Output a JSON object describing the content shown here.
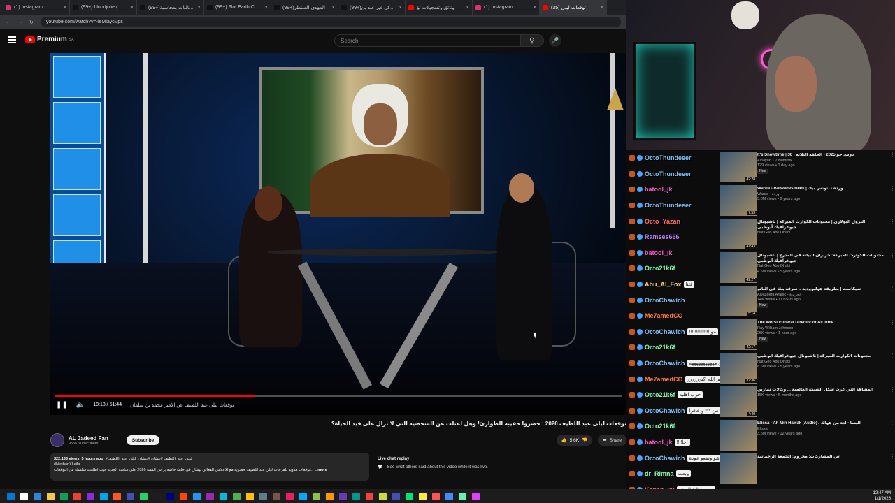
{
  "browser": {
    "tabs": [
      {
        "title": "(1) Instagram",
        "color": "#e1306c",
        "active": false
      },
      {
        "title": "(99+) blondjolie (@bl...",
        "color": "#111111",
        "active": false
      },
      {
        "title": "(99+)مطالبات بمحاسبة",
        "color": "#111111",
        "active": false
      },
      {
        "title": "(99+) Flat Earth Challe...",
        "color": "#111111",
        "active": false
      },
      {
        "title": "(99+)المهدي المنتظر",
        "color": "#111111",
        "active": false
      },
      {
        "title": "(99+)فهوكل غير عند بن",
        "color": "#111111",
        "active": false
      },
      {
        "title": "وثائق وتسجيلات تؤ",
        "color": "#ff0000",
        "active": false
      },
      {
        "title": "(1) Instagram",
        "color": "#e1306c",
        "active": false
      },
      {
        "title": "(35) توقعات ليلى",
        "color": "#ff0000",
        "active": true
      }
    ],
    "url": "youtube.com/watch?v=-leMiaycVps"
  },
  "youtube": {
    "logo_text": "Premium",
    "logo_region": "SA",
    "search_placeholder": "Search"
  },
  "player": {
    "time_current": "18:18",
    "time_total": "51:44",
    "time_display": "18:18 / 51:44",
    "chapter": "توقعات ليلى عبد اللطيف عن الأمير محمد بن سلمان",
    "progress_fraction": 0.354
  },
  "video": {
    "title": "توقعات ليلى عبد اللطيف 2026 : حضروا حقيبة الطوارئ! وهل اعتلت عن الشخصية التي لا تزال على قيد الحياة؟",
    "channel": "AL Jadeed Fan",
    "subscribers": "955K subscribers",
    "subscribe_label": "Subscribe",
    "likes": "5.6K",
    "share_label": "Share",
    "views": "322,133 views",
    "posted": "5 hours ago",
    "hashtags": "#ليلى_عبد_اللطيف #نيشان #نيشان_ليلى_عبد_اللطيف",
    "hashtag2": "#NeshanXLeila",
    "desc_text": "توقعات مدوية للفرحات ليلى عبد اللطيف حضرية مع الاعلامي الفعالي نيشان في حلقة خاصة برأس السنة 2026 على شاشة الجديد حيث اطلقت سلسلة من التوقعات...",
    "more_label": "...more"
  },
  "live_chat": {
    "title": "Live chat replay",
    "subtitle": "See what others said about this video while it was live."
  },
  "chat_messages": [
    {
      "user": "OctoThundeeer",
      "color": "#7ec8ff",
      "text": ""
    },
    {
      "user": "OctoThundeeer",
      "color": "#7ec8ff",
      "text": ""
    },
    {
      "user": "batool_jk",
      "color": "#ff5ad0",
      "text": ""
    },
    {
      "user": "OctoThundeeer",
      "color": "#7ec8ff",
      "text": ""
    },
    {
      "user": "Octo_Yazan",
      "color": "#ff6a6a",
      "text": ""
    },
    {
      "user": "Ramses666",
      "color": "#c77dff",
      "text": ""
    },
    {
      "user": "batool_jk",
      "color": "#ff5ad0",
      "text": ""
    },
    {
      "user": "Octo21k6f",
      "color": "#7dffb0",
      "text": ""
    },
    {
      "user": "Abu_Al_Fox",
      "color": "#ffd75a",
      "text": "فتنا"
    },
    {
      "user": "OctoChawich",
      "color": "#7ec8ff",
      "text": ""
    },
    {
      "user": "Me7amedCO",
      "color": "#ff7b3a",
      "text": ""
    },
    {
      "user": "OctoChawich",
      "color": "#7ec8ff",
      "text": "مو !!!!!!!!!!!!!!!"
    },
    {
      "user": "Octo21k6f",
      "color": "#7dffb0",
      "text": ""
    },
    {
      "user": "OctoChawich",
      "color": "#7ec8ff",
      "text": "وعدي هههههههههههه"
    },
    {
      "user": "Me7amedCO",
      "color": "#ff7b3a",
      "text": "تفجير الله اكبرررررر"
    },
    {
      "user": "Octo21k6f",
      "color": "#7dffb0",
      "text": "حرب اهليه"
    },
    {
      "user": "OctoChawich",
      "color": "#7ec8ff",
      "text": "ماسبدفين خلصنا من *** و عافرا"
    },
    {
      "user": "Octo21k6f",
      "color": "#7dffb0",
      "text": ""
    },
    {
      "user": "batool_jk",
      "color": "#ff5ad0",
      "text": "احا!!!!"
    },
    {
      "user": "OctoChawich",
      "color": "#7ec8ff",
      "text": "شو وضعو عودة"
    },
    {
      "user": "dr_Rimna",
      "color": "#7dffb0",
      "text": "وبعت"
    },
    {
      "user": "Kenan_xy",
      "color": "#ff6a6a",
      "text": "حرب اهلية الوضع"
    }
  ],
  "recommendations": [
    {
      "title": "It's Snowtime | 30 | دوس جو 2025 - الحلقة الثلاثة",
      "meta1": "Alhayah TV Network",
      "meta2": "129 views • 1 day ago",
      "badge": "New",
      "duration": "42:28"
    },
    {
      "title": "Warda - Batwanes Beek | وردة - بتونس بيك",
      "meta1": "Warda - وردة",
      "meta2": "3.8M views • 9 years ago",
      "badge": "",
      "duration": "7:53"
    },
    {
      "title": "الترول البولاري | مجنونات الكوارث المبركة | ناشيونال جيوغرافيك أبوظبي",
      "meta1": "Nat Geo Abu Dhabi",
      "meta2": "",
      "badge": "",
      "duration": "41:43"
    },
    {
      "title": "مجنونات الكوارث المبركة: حريزان البيانه في المدرج | ناشيونال جيوغرافيك أبوظبي",
      "meta1": "Nat Geo Abu Dhabi",
      "meta2": "4.5M views • 5 years ago",
      "badge": "",
      "duration": "42:27"
    },
    {
      "title": "شيكاست | بطريقة هوليوودية .. سرقة بنك في الناتو",
      "meta1": "AlJazeera Arabic - الجزيرة",
      "meta2": "14K views • 11 hours ago",
      "badge": "New",
      "duration": "5:14"
    },
    {
      "title": "The Worst Funeral Director of All Time",
      "meta1": "Ray William Johnson",
      "meta2": "25K views • 1 hour ago",
      "badge": "New",
      "duration": "42:17"
    },
    {
      "title": "مجنونات الكوارث المبركة | ناشيونال جيوغرافيك أبوظبي",
      "meta1": "Nat Geo Abu Dhabi",
      "meta2": "8.6M views • 5 years ago",
      "badge": "",
      "duration": "37:36"
    },
    {
      "title": "المشاهد التي عرت شكل الشبكة العالمية ... وكالات تمارين",
      "meta1": "",
      "meta2": "15K views • 5 months ago",
      "badge": "",
      "duration": "4:40"
    },
    {
      "title": "Elissa - Ah Min Hawak (Audio) / اليسا - أده من هواك",
      "meta1": "Elissa",
      "meta2": "3.5M views • 12 years ago",
      "badge": "",
      "duration": ""
    },
    {
      "title": "اس المشاركات: محروم: الجمعة الرحمانية",
      "meta1": "",
      "meta2": "",
      "badge": "",
      "duration": ""
    }
  ],
  "clock": {
    "time": "12:47 AM",
    "date": "1/1/2026"
  }
}
